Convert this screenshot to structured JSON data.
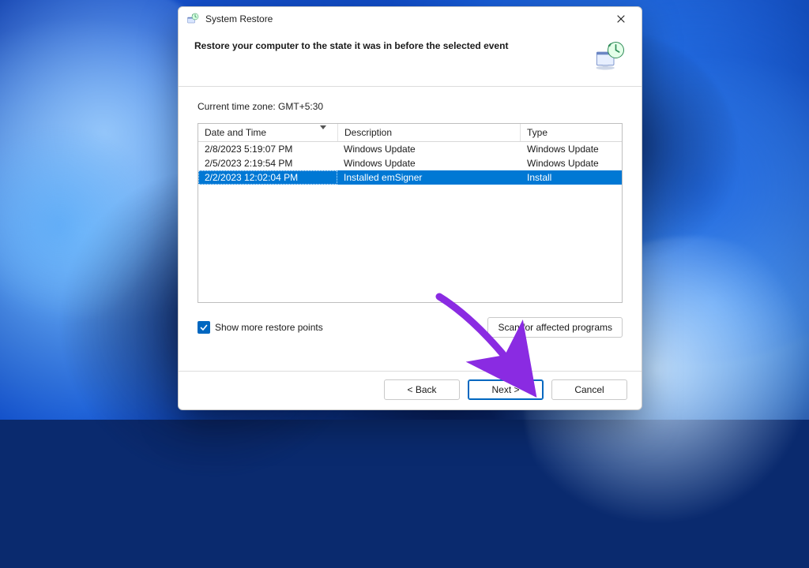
{
  "window": {
    "title": "System Restore",
    "heading": "Restore your computer to the state it was in before the selected event"
  },
  "timezone_label": "Current time zone: GMT+5:30",
  "table": {
    "columns": {
      "datetime": "Date and Time",
      "description": "Description",
      "type": "Type"
    },
    "rows": [
      {
        "datetime": "2/8/2023 5:19:07 PM",
        "description": "Windows Update",
        "type": "Windows Update",
        "selected": false
      },
      {
        "datetime": "2/5/2023 2:19:54 PM",
        "description": "Windows Update",
        "type": "Windows Update",
        "selected": false
      },
      {
        "datetime": "2/2/2023 12:02:04 PM",
        "description": "Installed emSigner",
        "type": "Install",
        "selected": true
      }
    ]
  },
  "show_more": {
    "label": "Show more restore points",
    "checked": true
  },
  "buttons": {
    "scan": "Scan for affected programs",
    "back": "< Back",
    "next": "Next >",
    "cancel": "Cancel"
  },
  "annotation": {
    "arrow_color": "#8a2be2"
  }
}
